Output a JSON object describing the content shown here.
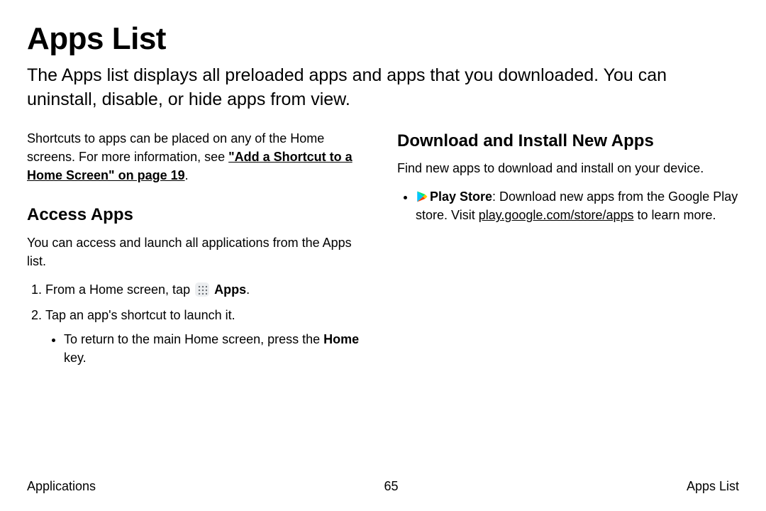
{
  "title": "Apps List",
  "intro": "The Apps list displays all preloaded apps and apps that you downloaded. You can uninstall, disable, or hide apps from view.",
  "left": {
    "shortcuts_lead": "Shortcuts to apps can be placed on any of the Home screens. For more information, see ",
    "shortcuts_xref": "\"Add a Shortcut to a Home Screen\" on page 19",
    "shortcuts_tail": ".",
    "access_heading": "Access Apps",
    "access_intro": "You can access and launch all applications from the Apps list.",
    "step1_lead": "From a Home screen, tap ",
    "step1_bold": "Apps",
    "step1_tail": ".",
    "step2": "Tap an app's shortcut to launch it.",
    "sub_lead": "To return to the main Home screen, press the ",
    "sub_bold": "Home",
    "sub_tail": " key."
  },
  "right": {
    "heading": "Download and Install New Apps",
    "intro": "Find new apps to download and install on your device.",
    "play_label": "Play Store",
    "play_lead2": ": Download new apps from the Google Play store. Visit ",
    "play_link": "play.google.com/store/apps",
    "play_tail": " to learn more."
  },
  "footer": {
    "left": "Applications",
    "center": "65",
    "right": "Apps List"
  }
}
